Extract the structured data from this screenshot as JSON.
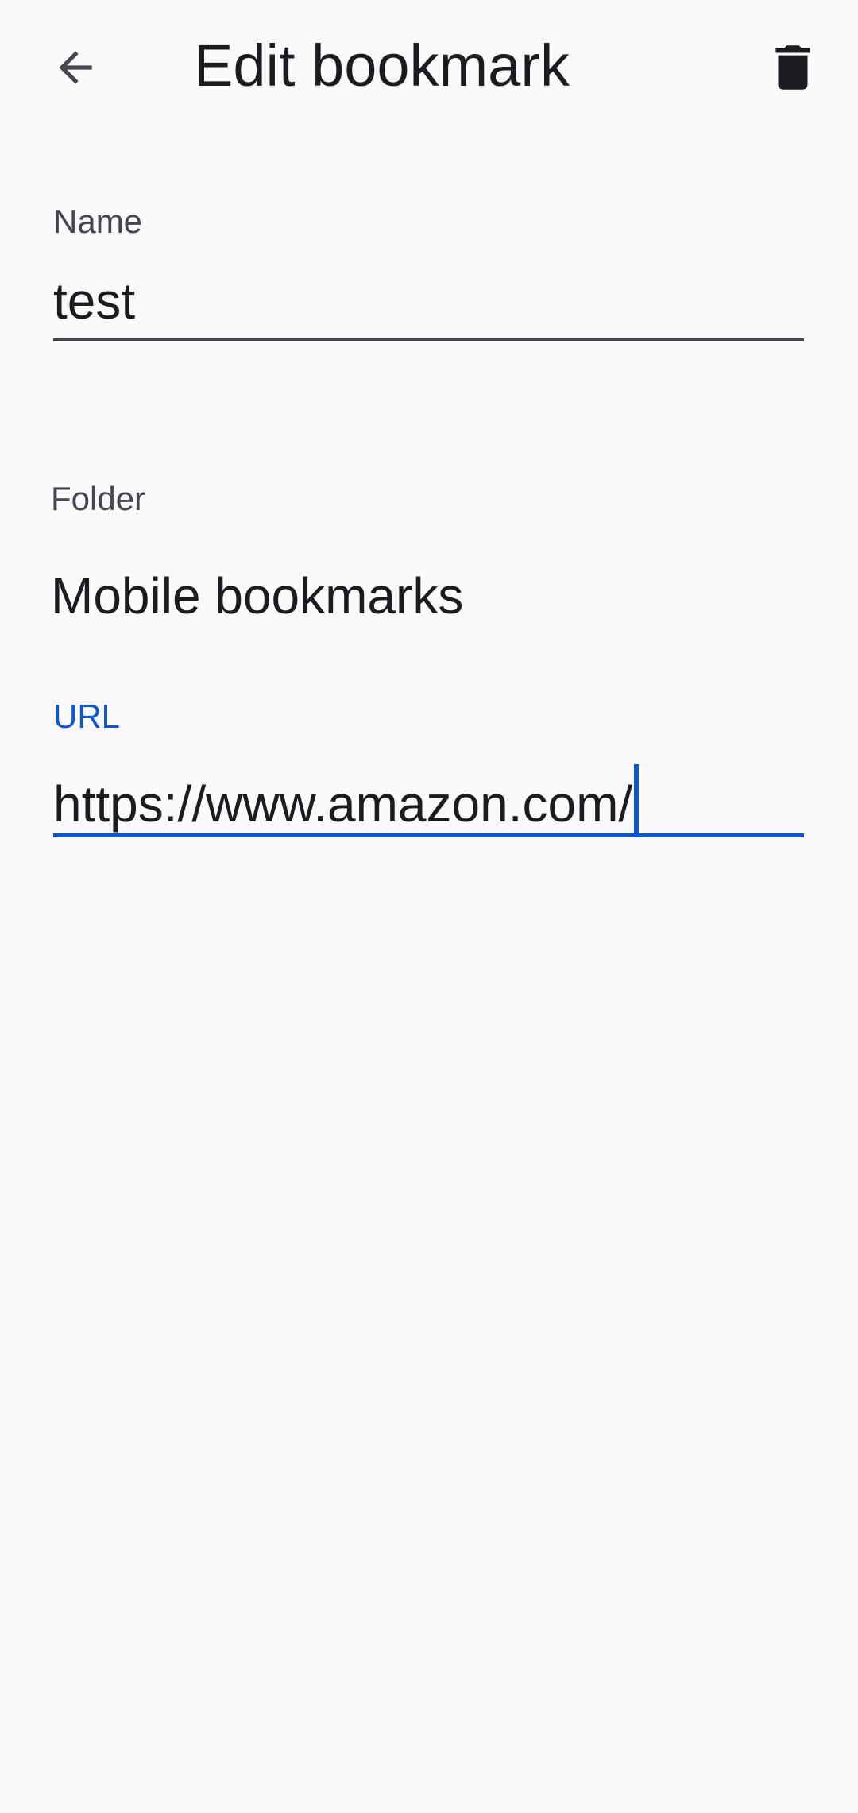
{
  "toolbar": {
    "title": "Edit bookmark",
    "back_icon": "arrow-back-icon",
    "delete_icon": "trash-icon"
  },
  "fields": {
    "name": {
      "label": "Name",
      "value": "test"
    },
    "folder": {
      "label": "Folder",
      "value": "Mobile bookmarks"
    },
    "url": {
      "label": "URL",
      "value": "https://www.amazon.com/"
    }
  },
  "colors": {
    "background": "#fcf9fd",
    "text": "#1c1b1f",
    "label": "#45464f",
    "accent": "#0b57d0"
  }
}
